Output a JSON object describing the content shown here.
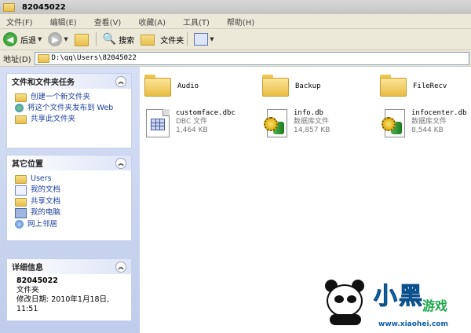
{
  "window": {
    "title": "82045022"
  },
  "menu": [
    "文件(F)",
    "编辑(E)",
    "查看(V)",
    "收藏(A)",
    "工具(T)",
    "帮助(H)"
  ],
  "toolbar": {
    "back": "后退",
    "search": "搜索",
    "folders": "文件夹"
  },
  "address": {
    "label": "地址(D)",
    "value": "D:\\qq\\Users\\82045022"
  },
  "tasks": {
    "file_tasks": {
      "title": "文件和文件夹任务",
      "items": [
        "创建一个新文件夹",
        "将这个文件夹发布到 Web",
        "共享此文件夹"
      ]
    },
    "other_places": {
      "title": "其它位置",
      "items": [
        "Users",
        "我的文档",
        "共享文档",
        "我的电脑",
        "网上邻居"
      ]
    },
    "details": {
      "title": "详细信息",
      "name": "82045022",
      "type": "文件夹",
      "modified": "修改日期: 2010年1月18日, 11:51"
    }
  },
  "files": [
    {
      "name": "Audio",
      "kind": "folder"
    },
    {
      "name": "Backup",
      "kind": "folder"
    },
    {
      "name": "FileRecv",
      "kind": "folder"
    },
    {
      "name": "customface.dbc",
      "type": "DBC 文件",
      "size": "1,464 KB",
      "kind": "dbc"
    },
    {
      "name": "info.db",
      "type": "数据库文件",
      "size": "14,857 KB",
      "kind": "db"
    },
    {
      "name": "infocenter.db",
      "type": "数据库文件",
      "size": "8,544 KB",
      "kind": "db"
    }
  ],
  "watermark": {
    "text": "小黑",
    "sub": "游戏",
    "url": "www.xiaohei.com"
  }
}
